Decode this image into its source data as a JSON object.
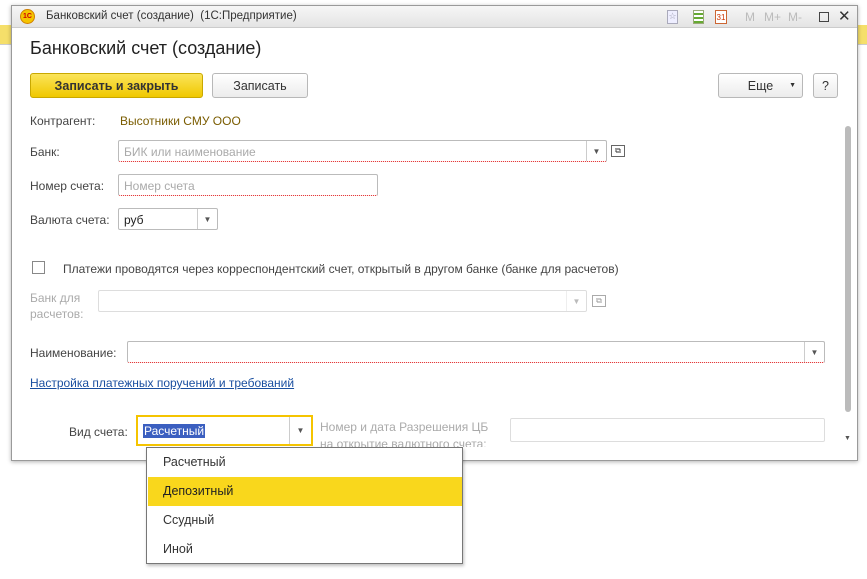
{
  "window": {
    "title": "Банковский счет (создание)  (1С:Предприятие)",
    "toolbar_icons": [
      "favorite-icon",
      "calculator-icon",
      "calendar-icon"
    ],
    "memory_buttons": [
      "M",
      "M+",
      "M-"
    ]
  },
  "form": {
    "title": "Банковский счет (создание)",
    "save_close": "Записать и закрыть",
    "save": "Записать",
    "more": "Еще",
    "help": "?",
    "counterparty_label": "Контрагент:",
    "counterparty_value": "Высотники СМУ ООО",
    "bank_label": "Банк:",
    "bank_placeholder": "БИК или наименование",
    "account_label": "Номер счета:",
    "account_placeholder": "Номер счета",
    "currency_label": "Валюта счета:",
    "currency_value": "руб",
    "corr_checkbox_label": "Платежи проводятся через корреспондентский счет, открытый в другом банке (банке для расчетов)",
    "settle_bank_label_1": "Банк для",
    "settle_bank_label_2": "расчетов:",
    "name_label": "Наименование:",
    "settings_link": "Настройка платежных поручений и требований",
    "account_type_label": "Вид счета:",
    "account_type_value": "Расчетный",
    "permit_label_1": "Номер и дата Разрешения ЦБ",
    "permit_label_2": "на открытие валютного счета:"
  },
  "dropdown": {
    "options": [
      "Расчетный",
      "Депозитный",
      "Ссудный",
      "Иной"
    ],
    "highlighted": "Депозитный"
  },
  "colors": {
    "accent": "#f9d71c",
    "link": "#1a4fa0",
    "counterparty": "#7a5c00",
    "selection": "#3b5fc0"
  }
}
